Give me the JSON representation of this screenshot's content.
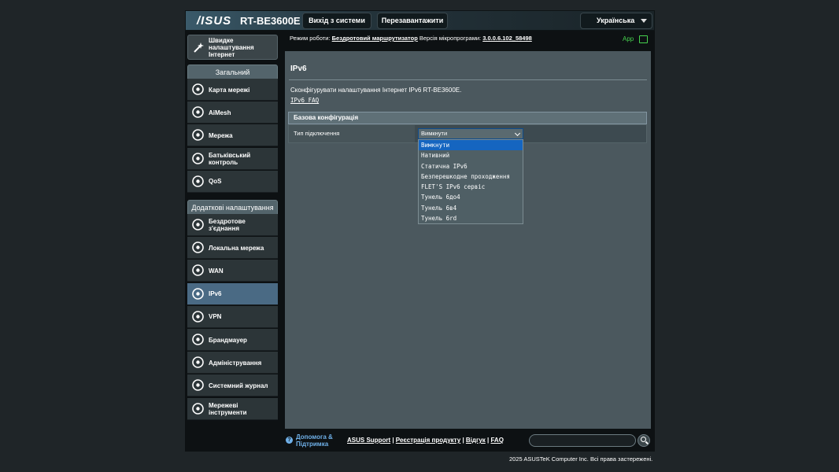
{
  "header": {
    "logo": "/ISUS",
    "model": "RT-BE3600E",
    "logout_label": "Вихід з системи",
    "reboot_label": "Перезавантажити",
    "language": "Українська"
  },
  "sidebar": {
    "quick_setup": "Швидке налаштування Інтернет",
    "general_header": "Загальний",
    "general_items": [
      {
        "label": "Карта мережі",
        "icon": "network-map-icon"
      },
      {
        "label": "AiMesh",
        "icon": "aimesh-icon"
      },
      {
        "label": "Мережа",
        "icon": "guest-network-icon"
      },
      {
        "label": "Батьківський контроль",
        "icon": "parental-control-icon"
      },
      {
        "label": "QoS",
        "icon": "qos-icon"
      }
    ],
    "advanced_header": "Додаткові налаштування",
    "advanced_items": [
      {
        "label": "Бездротове з'єднання",
        "icon": "wireless-icon"
      },
      {
        "label": "Локальна мережа",
        "icon": "lan-icon"
      },
      {
        "label": "WAN",
        "icon": "wan-icon"
      },
      {
        "label": "IPv6",
        "icon": "ipv6-icon"
      },
      {
        "label": "VPN",
        "icon": "vpn-icon"
      },
      {
        "label": "Брандмауер",
        "icon": "firewall-icon"
      },
      {
        "label": "Адміністрування",
        "icon": "administration-icon"
      },
      {
        "label": "Системний журнал",
        "icon": "system-log-icon"
      },
      {
        "label": "Мережеві інструменти",
        "icon": "network-tools-icon"
      }
    ]
  },
  "status": {
    "mode_label": "Режим роботи:",
    "mode_value": "Бездротовий маршрутизатор",
    "fw_label": "Версія мікропрограми:",
    "fw_value": "3.0.0.6.102_58498",
    "app_label": "App"
  },
  "main": {
    "title": "IPv6",
    "description": "Сконфігурувати налаштування Інтернет IPv6 RT-BE3600E.",
    "faq_link": "IPv6 FAQ",
    "section_header": "Базова конфігурація",
    "connection_type_label": "Тип підключення",
    "connection_type_value": "Вимкнути",
    "connection_type_options": [
      "Вимкнути",
      "Нативний",
      "Статична IPv6",
      "Безперешкодне проходження",
      "FLET'S IPv6 сервіс",
      "Тунель 6до4",
      "Тунель 6в4",
      "Тунель 6rd"
    ]
  },
  "footer": {
    "help_label": "Допомога & Підтримка",
    "links": [
      "ASUS Support",
      "Реєстрація продукту",
      "Відгук",
      "FAQ"
    ],
    "copyright": "2025 ASUSTeK Computer Inc. Всі права застережені."
  },
  "colors": {
    "accent_active": "#4a6a84",
    "selected_option": "#1565c0",
    "app_green": "#46d24e"
  }
}
